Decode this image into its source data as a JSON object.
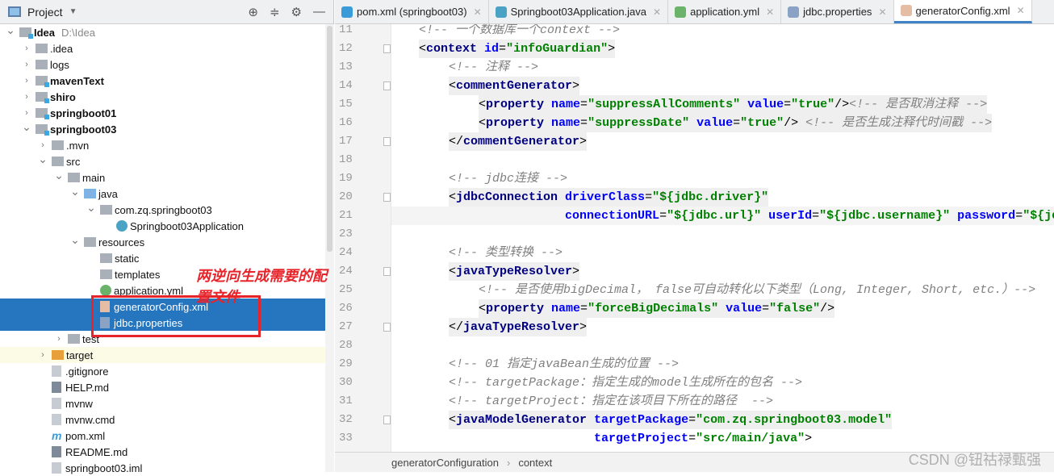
{
  "project_panel": {
    "title": "Project",
    "toolbar_icons": [
      "locate-icon",
      "collapse-icon",
      "gear-icon",
      "minimize-icon"
    ]
  },
  "tree": [
    {
      "label": "Idea",
      "path": "D:\\Idea",
      "level": 0,
      "open": true,
      "icon": "module",
      "bold": true
    },
    {
      "label": ".idea",
      "level": 1,
      "open": false,
      "icon": "folder"
    },
    {
      "label": "logs",
      "level": 1,
      "open": false,
      "icon": "folder"
    },
    {
      "label": "mavenText",
      "level": 1,
      "open": false,
      "icon": "module",
      "bold": true
    },
    {
      "label": "shiro",
      "level": 1,
      "open": false,
      "icon": "module",
      "bold": true
    },
    {
      "label": "springboot01",
      "level": 1,
      "open": false,
      "icon": "module",
      "bold": true
    },
    {
      "label": "springboot03",
      "level": 1,
      "open": true,
      "icon": "module",
      "bold": true
    },
    {
      "label": ".mvn",
      "level": 2,
      "open": false,
      "icon": "folder"
    },
    {
      "label": "src",
      "level": 2,
      "open": true,
      "icon": "folder"
    },
    {
      "label": "main",
      "level": 3,
      "open": true,
      "icon": "folder"
    },
    {
      "label": "java",
      "level": 4,
      "open": true,
      "icon": "blue"
    },
    {
      "label": "com.zq.springboot03",
      "level": 5,
      "open": true,
      "icon": "folder"
    },
    {
      "label": "Springboot03Application",
      "level": 6,
      "icon": "java"
    },
    {
      "label": "resources",
      "level": 4,
      "open": true,
      "icon": "folder"
    },
    {
      "label": "static",
      "level": 5,
      "icon": "folder"
    },
    {
      "label": "templates",
      "level": 5,
      "icon": "folder"
    },
    {
      "label": "application.yml",
      "level": 5,
      "icon": "yml"
    },
    {
      "label": "generatorConfig.xml",
      "level": 5,
      "icon": "xml",
      "selected": true
    },
    {
      "label": "jdbc.properties",
      "level": 5,
      "icon": "prop",
      "selected": true
    },
    {
      "label": "test",
      "level": 3,
      "open": false,
      "icon": "folder"
    },
    {
      "label": "target",
      "level": 2,
      "open": false,
      "icon": "orange",
      "highlight": true
    },
    {
      "label": ".gitignore",
      "level": 2,
      "icon": "file"
    },
    {
      "label": "HELP.md",
      "level": 2,
      "icon": "md"
    },
    {
      "label": "mvnw",
      "level": 2,
      "icon": "file"
    },
    {
      "label": "mvnw.cmd",
      "level": 2,
      "icon": "file"
    },
    {
      "label": "pom.xml",
      "level": 2,
      "icon": "pom"
    },
    {
      "label": "README.md",
      "level": 2,
      "icon": "md"
    },
    {
      "label": "springboot03.iml",
      "level": 2,
      "icon": "file"
    }
  ],
  "annotation": "两逆向生成需要的配置文件",
  "tabs": [
    {
      "label": "pom.xml (springboot03)",
      "icon": "maven",
      "color": "#3a9bd9"
    },
    {
      "label": "Springboot03Application.java",
      "icon": "java",
      "color": "#4aa3c4"
    },
    {
      "label": "application.yml",
      "icon": "yml",
      "color": "#6bb36b"
    },
    {
      "label": "jdbc.properties",
      "icon": "prop",
      "color": "#8aa3c4"
    },
    {
      "label": "generatorConfig.xml",
      "icon": "xml",
      "color": "#e5bca4",
      "active": true
    }
  ],
  "code": [
    {
      "n": 11,
      "indent": 1,
      "tokens": [
        [
          "com",
          "<!-- 一个数据库一个context -->"
        ]
      ]
    },
    {
      "n": 12,
      "indent": 1,
      "fold": true,
      "tag": true,
      "tokens": [
        [
          "p",
          "<"
        ],
        [
          "tag",
          "context "
        ],
        [
          "attr",
          "id"
        ],
        [
          "p",
          "="
        ],
        [
          "val",
          "\"infoGuardian\""
        ],
        [
          "p",
          ">"
        ]
      ]
    },
    {
      "n": 13,
      "indent": 2,
      "tokens": [
        [
          "com",
          "<!-- 注释 -->"
        ]
      ]
    },
    {
      "n": 14,
      "indent": 2,
      "fold": true,
      "tag": true,
      "tokens": [
        [
          "p",
          "<"
        ],
        [
          "tag",
          "commentGenerator"
        ],
        [
          "p",
          ">"
        ]
      ]
    },
    {
      "n": 15,
      "indent": 3,
      "tag": true,
      "tokens": [
        [
          "p",
          "<"
        ],
        [
          "tag",
          "property "
        ],
        [
          "attr",
          "name"
        ],
        [
          "p",
          "="
        ],
        [
          "val",
          "\"suppressAllComments\" "
        ],
        [
          "attr",
          "value"
        ],
        [
          "p",
          "="
        ],
        [
          "val",
          "\"true\""
        ],
        [
          "p",
          "/>"
        ],
        [
          "com",
          "<!-- 是否取消注释 -->"
        ]
      ]
    },
    {
      "n": 16,
      "indent": 3,
      "tag": true,
      "tokens": [
        [
          "p",
          "<"
        ],
        [
          "tag",
          "property "
        ],
        [
          "attr",
          "name"
        ],
        [
          "p",
          "="
        ],
        [
          "val",
          "\"suppressDate\" "
        ],
        [
          "attr",
          "value"
        ],
        [
          "p",
          "="
        ],
        [
          "val",
          "\"true\""
        ],
        [
          "p",
          "/> "
        ],
        [
          "com",
          "<!-- 是否生成注释代时间戳 -->"
        ]
      ]
    },
    {
      "n": 17,
      "indent": 2,
      "fold": true,
      "tag": true,
      "tokens": [
        [
          "p",
          "</"
        ],
        [
          "tag",
          "commentGenerator"
        ],
        [
          "p",
          ">"
        ]
      ]
    },
    {
      "n": 18,
      "indent": 0,
      "tokens": []
    },
    {
      "n": 19,
      "indent": 2,
      "tokens": [
        [
          "com",
          "<!-- jdbc连接 -->"
        ]
      ]
    },
    {
      "n": 20,
      "indent": 2,
      "fold": true,
      "tag": true,
      "tokens": [
        [
          "p",
          "<"
        ],
        [
          "tag",
          "jdbcConnection "
        ],
        [
          "attr",
          "driverClass"
        ],
        [
          "p",
          "="
        ],
        [
          "val",
          "\"${jdbc.driver}\""
        ]
      ]
    },
    {
      "n": 21,
      "indent": 2,
      "cur": true,
      "tokens": [
        [
          "p",
          "                "
        ],
        [
          "attr",
          "connectionURL"
        ],
        [
          "p",
          "="
        ],
        [
          "val",
          "\"${jdbc.url}\" "
        ],
        [
          "attr",
          "userId"
        ],
        [
          "p",
          "="
        ],
        [
          "val",
          "\"${jdbc.username}\" "
        ],
        [
          "attr",
          "password"
        ],
        [
          "p",
          "="
        ],
        [
          "val",
          "\"${jdbc.password}\""
        ]
      ]
    },
    {
      "n": 23,
      "indent": 0,
      "tokens": []
    },
    {
      "n": 24,
      "indent": 2,
      "tokens": [
        [
          "com",
          "<!-- 类型转换 -->"
        ]
      ]
    },
    {
      "n": 24,
      "indent": 2,
      "fold": true,
      "tag": true,
      "tokens": [
        [
          "p",
          "<"
        ],
        [
          "tag",
          "javaTypeResolver"
        ],
        [
          "p",
          ">"
        ]
      ]
    },
    {
      "n": 25,
      "indent": 3,
      "tokens": [
        [
          "com",
          "<!-- 是否使用bigDecimal， false可自动转化以下类型（Long, Integer, Short, etc.）-->"
        ]
      ]
    },
    {
      "n": 26,
      "indent": 3,
      "tag": true,
      "tokens": [
        [
          "p",
          "<"
        ],
        [
          "tag",
          "property "
        ],
        [
          "attr",
          "name"
        ],
        [
          "p",
          "="
        ],
        [
          "val",
          "\"forceBigDecimals\" "
        ],
        [
          "attr",
          "value"
        ],
        [
          "p",
          "="
        ],
        [
          "val",
          "\"false\""
        ],
        [
          "p",
          "/>"
        ]
      ]
    },
    {
      "n": 27,
      "indent": 2,
      "fold": true,
      "tag": true,
      "tokens": [
        [
          "p",
          "</"
        ],
        [
          "tag",
          "javaTypeResolver"
        ],
        [
          "p",
          ">"
        ]
      ]
    },
    {
      "n": 28,
      "indent": 0,
      "tokens": []
    },
    {
      "n": 29,
      "indent": 2,
      "tokens": [
        [
          "com",
          "<!-- 01 指定javaBean生成的位置 -->"
        ]
      ]
    },
    {
      "n": 30,
      "indent": 2,
      "tokens": [
        [
          "com",
          "<!-- targetPackage：指定生成的model生成所在的包名 -->"
        ]
      ]
    },
    {
      "n": 31,
      "indent": 2,
      "tokens": [
        [
          "com",
          "<!-- targetProject：指定在该项目下所在的路径  -->"
        ]
      ]
    },
    {
      "n": 32,
      "indent": 2,
      "fold": true,
      "tag": true,
      "tokens": [
        [
          "p",
          "<"
        ],
        [
          "tag",
          "javaModelGenerator "
        ],
        [
          "attr",
          "targetPackage"
        ],
        [
          "p",
          "="
        ],
        [
          "val",
          "\"com.zq.springboot03.model\""
        ]
      ]
    },
    {
      "n": 33,
      "indent": 2,
      "tokens": [
        [
          "p",
          "                    "
        ],
        [
          "attr",
          "targetProject"
        ],
        [
          "p",
          "="
        ],
        [
          "val",
          "\"src/main/java\""
        ],
        [
          "p",
          ">"
        ]
      ]
    }
  ],
  "breadcrumb": [
    "generatorConfiguration",
    "context"
  ],
  "watermark": "CSDN @钮祜禄甄强"
}
